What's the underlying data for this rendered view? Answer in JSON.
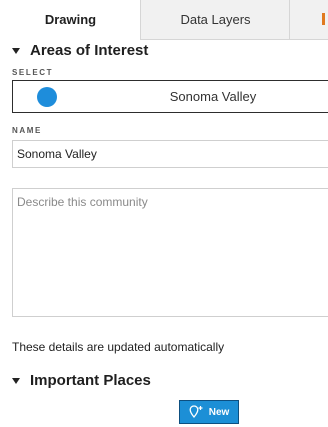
{
  "tabs": {
    "drawing": "Drawing",
    "data_layers": "Data Layers"
  },
  "areas": {
    "title": "Areas of Interest",
    "select_label": "SELECT",
    "selected_value": "Sonoma Valley",
    "selected_color": "#1e8ddb",
    "name_label": "NAME",
    "name_value": "Sonoma Valley",
    "description_placeholder": "Describe this community",
    "autosave_note": "These details are updated automatically"
  },
  "places": {
    "title": "Important Places",
    "new_button_label": "New",
    "new_button_icon": "map-pin-plus-icon"
  },
  "colors": {
    "accent": "#1c8fd6",
    "tab_marker": "#e07a1f"
  }
}
